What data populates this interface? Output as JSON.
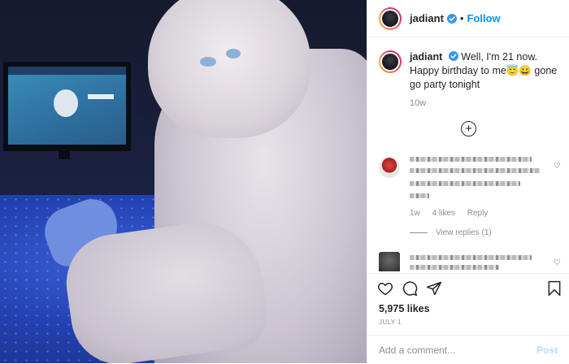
{
  "post": {
    "username": "jadiant",
    "follow_label": "Follow",
    "separator": "•",
    "caption_text": "Well, I'm 21 now. Happy birthday to me😇😀 gone go party tonight",
    "age": "10w",
    "likes": "5,975 likes",
    "date": "JULY 1"
  },
  "load_more": {
    "icon": "plus-circle-icon",
    "symbol": "+"
  },
  "comments": [
    {
      "meta_time": "1w",
      "meta_likes": "4 likes",
      "meta_reply": "Reply",
      "view_replies": "View replies (1)"
    },
    {
      "meta_time": "",
      "meta_likes": "",
      "meta_reply": "",
      "view_replies": ""
    }
  ],
  "actions": {
    "icons": [
      "heart-icon",
      "comment-icon",
      "share-icon",
      "bookmark-icon"
    ]
  },
  "comment_box": {
    "placeholder": "Add a comment...",
    "post_label": "Post"
  },
  "colors": {
    "accent": "#0095f6",
    "text": "#262626",
    "muted": "#8e8e8e",
    "post_disabled": "#b2dffc"
  }
}
